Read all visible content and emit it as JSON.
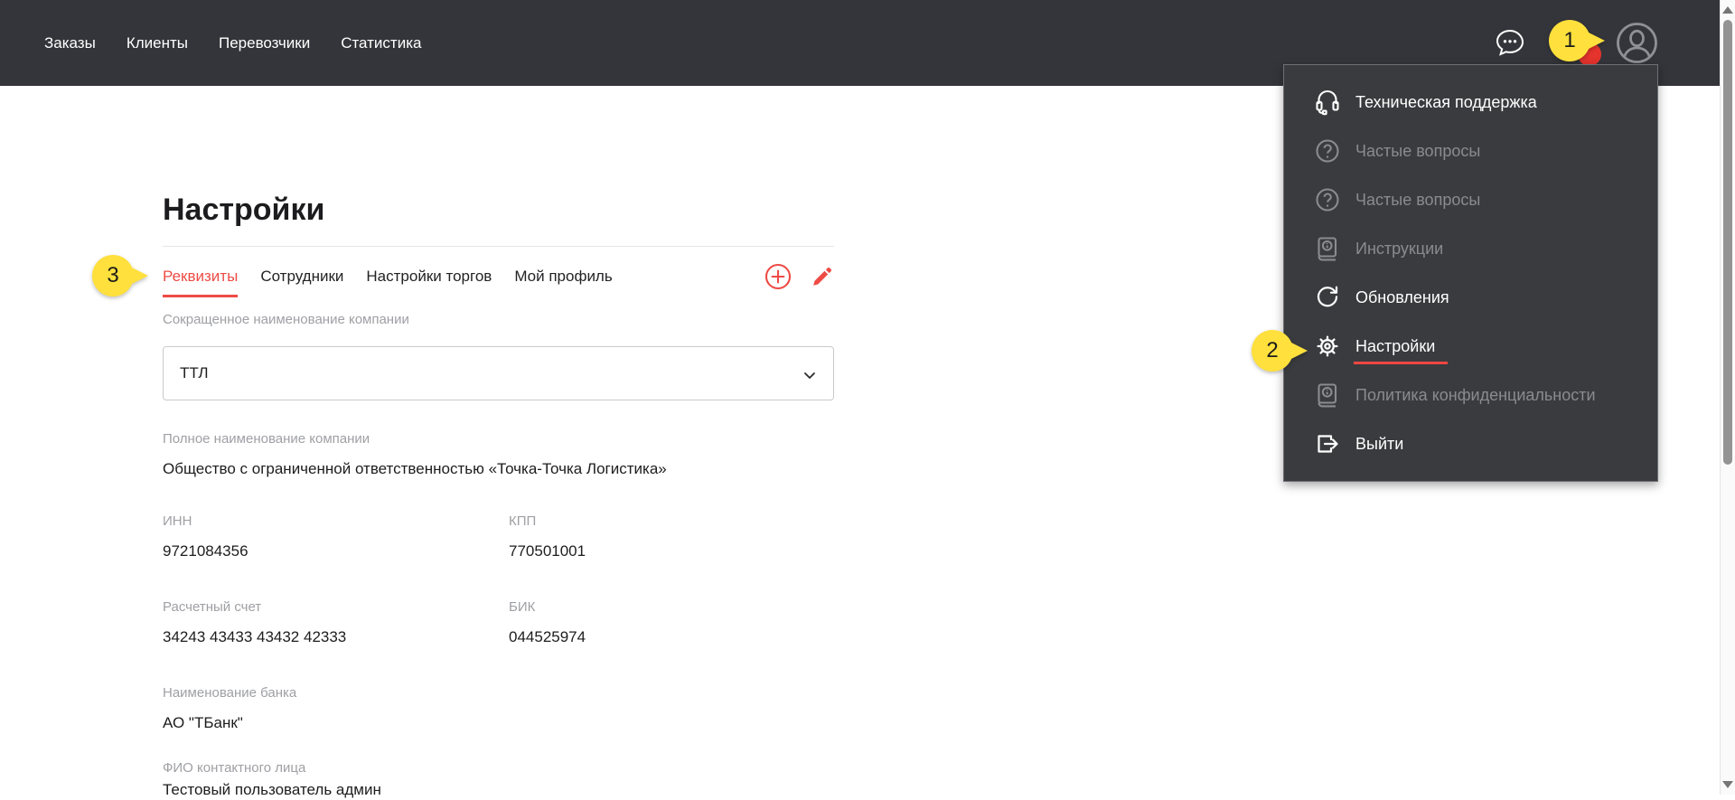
{
  "colors": {
    "accent_red": "#ee4b45",
    "balloon_yellow": "#ffe03c",
    "navbar_bg": "#34353a",
    "dropdown_bg": "#3a3b3f",
    "disabled_text": "#8a8b8f",
    "badge_red": "#e5332d"
  },
  "navbar": {
    "items": [
      {
        "label": "Заказы"
      },
      {
        "label": "Клиенты"
      },
      {
        "label": "Перевозчики"
      },
      {
        "label": "Статистика"
      }
    ],
    "icons": [
      {
        "name": "chat-bubble-icon"
      },
      {
        "name": "user-profile-icon"
      },
      {
        "name": "notification-badge"
      }
    ]
  },
  "annotations": {
    "step1": "1",
    "step2": "2",
    "step3": "3"
  },
  "dropdown": {
    "items": [
      {
        "label": "Техническая поддержка",
        "icon": "headset-icon",
        "enabled": true,
        "highlighted": false
      },
      {
        "label": "Частые вопросы",
        "icon": "question-circle-icon",
        "enabled": false,
        "highlighted": false
      },
      {
        "label": "Частые вопросы",
        "icon": "question-circle-icon",
        "enabled": false,
        "highlighted": false
      },
      {
        "label": "Инструкции",
        "icon": "instructions-book-icon",
        "enabled": false,
        "highlighted": false
      },
      {
        "label": "Обновления",
        "icon": "refresh-icon",
        "enabled": true,
        "highlighted": false
      },
      {
        "label": "Настройки",
        "icon": "gear-icon",
        "enabled": true,
        "highlighted": true
      },
      {
        "label": "Политика конфиденциальности",
        "icon": "policy-book-icon",
        "enabled": false,
        "highlighted": false
      },
      {
        "label": "Выйти",
        "icon": "logout-icon",
        "enabled": true,
        "highlighted": false
      }
    ]
  },
  "page": {
    "title": "Настройки"
  },
  "tabs": {
    "items": [
      {
        "label": "Реквизиты",
        "active": true
      },
      {
        "label": "Сотрудники",
        "active": false
      },
      {
        "label": "Настройки торгов",
        "active": false
      },
      {
        "label": "Мой профиль",
        "active": false
      }
    ],
    "icons": [
      {
        "name": "add-circle-icon"
      },
      {
        "name": "edit-pencil-icon"
      }
    ]
  },
  "form": {
    "short_name": {
      "label": "Сокращенное наименование компании",
      "value": "ТТЛ"
    },
    "full_name": {
      "label": "Полное наименование компании",
      "value": "Общество с ограниченной ответственностью «Точка-Точка Логистика»"
    },
    "inn": {
      "label": "ИНН",
      "value": "9721084356"
    },
    "kpp": {
      "label": "КПП",
      "value": "770501001"
    },
    "account": {
      "label": "Расчетный счет",
      "value": "34243 43433 43432 42333"
    },
    "bik": {
      "label": "БИК",
      "value": "044525974"
    },
    "bank": {
      "label": "Наименование банка",
      "value": "АО \"ТБанк\""
    },
    "contact": {
      "label": "ФИО контактного лица",
      "value": "Тестовый пользователь админ"
    }
  }
}
